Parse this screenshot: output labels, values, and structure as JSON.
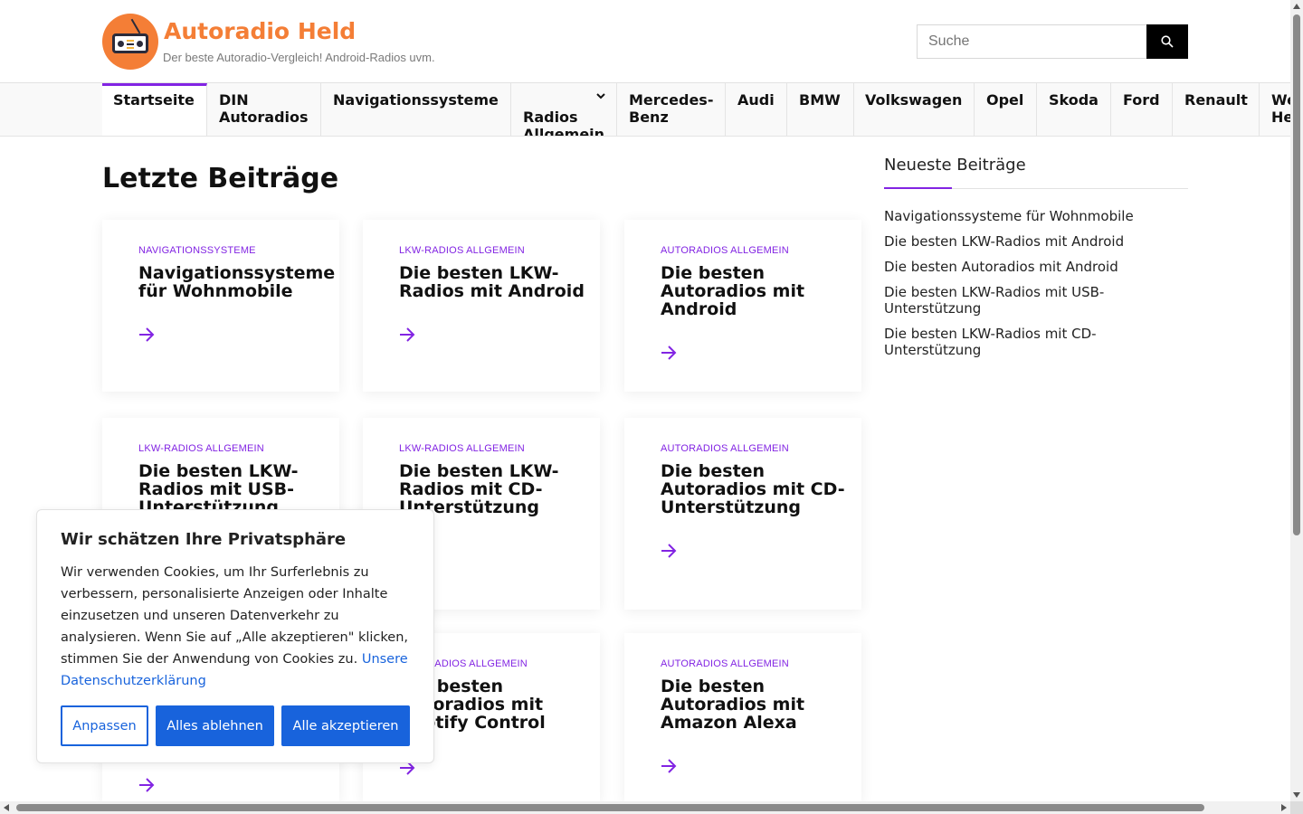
{
  "site": {
    "title": "Autoradio Held",
    "tagline": "Der beste Autoradio-Vergleich! Android-Radios uvm.",
    "accent_color": "#8224e3",
    "brand_color": "#f47e36"
  },
  "search": {
    "placeholder": "Suche",
    "icon": "search-icon"
  },
  "nav": {
    "items": [
      {
        "label": "Startseite",
        "active": true
      },
      {
        "label": "DIN\nAutoradios"
      },
      {
        "label": "Navigationssysteme"
      },
      {
        "label": "Radios\nAllgemein",
        "has_dropdown": true
      },
      {
        "label": "Mercedes-\nBenz"
      },
      {
        "label": "Audi"
      },
      {
        "label": "BMW"
      },
      {
        "label": "Volkswagen"
      },
      {
        "label": "Opel"
      },
      {
        "label": "Skoda"
      },
      {
        "label": "Ford"
      },
      {
        "label": "Renault"
      },
      {
        "label": "We\nHe"
      }
    ]
  },
  "main": {
    "heading": "Letzte Beiträge",
    "posts": [
      {
        "category": "Navigationssysteme",
        "title": "Navigationssysteme für Wohnmobile"
      },
      {
        "category": "LKW-Radios Allgemein",
        "title": "Die besten LKW-Radios mit Android"
      },
      {
        "category": "Autoradios Allgemein",
        "title": "Die besten Autoradios mit Android"
      },
      {
        "category": "LKW-Radios Allgemein",
        "title": "Die besten LKW-Radios mit USB-Unterstützung"
      },
      {
        "category": "LKW-Radios Allgemein",
        "title": "Die besten LKW-Radios mit CD-Unterstützung"
      },
      {
        "category": "Autoradios Allgemein",
        "title": "Die besten Autoradios mit CD-Unterstützung"
      },
      {
        "category": "",
        "title": ""
      },
      {
        "category": "Autoradios Allgemein",
        "title": "Die besten Autoradios mit Spotify Control"
      },
      {
        "category": "Autoradios Allgemein",
        "title": "Die besten Autoradios mit Amazon Alexa"
      }
    ]
  },
  "sidebar": {
    "heading": "Neueste Beiträge",
    "links": [
      "Navigationssysteme für Wohnmobile",
      "Die besten LKW-Radios mit Android",
      "Die besten Autoradios mit Android",
      "Die besten LKW-Radios mit USB-Unterstützung",
      "Die besten LKW-Radios mit CD-Unterstützung"
    ]
  },
  "cookie": {
    "heading": "Wir schätzen Ihre Privatsphäre",
    "text": "Wir verwenden Cookies, um Ihr Surferlebnis zu verbessern, personalisierte Anzeigen oder Inhalte einzusetzen und unseren Datenverkehr zu analysieren. Wenn Sie auf „Alle akzeptieren\" klicken, stimmen Sie der Anwendung von Cookies zu.",
    "policy_link": "Unsere Datenschutzerklärung",
    "customize_label": "Anpassen",
    "reject_label": "Alles ablehnen",
    "accept_label": "Alle akzeptieren",
    "button_color": "#1863dc"
  }
}
